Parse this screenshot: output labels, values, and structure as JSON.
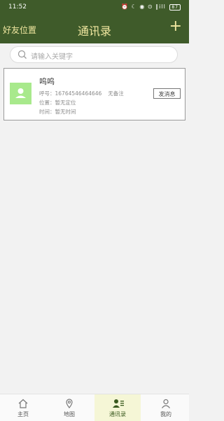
{
  "status_bar": {
    "time": "11:52",
    "icons_text": "⏰ ☾ ◉ ⊙ ∥ill ",
    "battery": "87"
  },
  "header": {
    "left_label": "好友位置",
    "title": "通讯录",
    "add_symbol": "+"
  },
  "search": {
    "placeholder": "请输入关键字"
  },
  "contacts": [
    {
      "name": "呜呜",
      "phone": "呼号：16764546464646",
      "note": "无备注",
      "location": "位置：暂无定位",
      "time": "时间：暂无时间",
      "action_label": "发消息"
    }
  ],
  "tabbar": {
    "items": [
      {
        "label": "主页",
        "icon": "home-icon"
      },
      {
        "label": "地图",
        "icon": "map-pin-icon"
      },
      {
        "label": "通讯录",
        "icon": "contacts-icon",
        "active": true
      },
      {
        "label": "我的",
        "icon": "user-icon"
      }
    ]
  },
  "colors": {
    "header_bg": "#3f5b2a",
    "header_text": "#f0e7a0",
    "avatar_bg": "#a8e98c",
    "active_tab_bg": "#f5f6d6"
  }
}
